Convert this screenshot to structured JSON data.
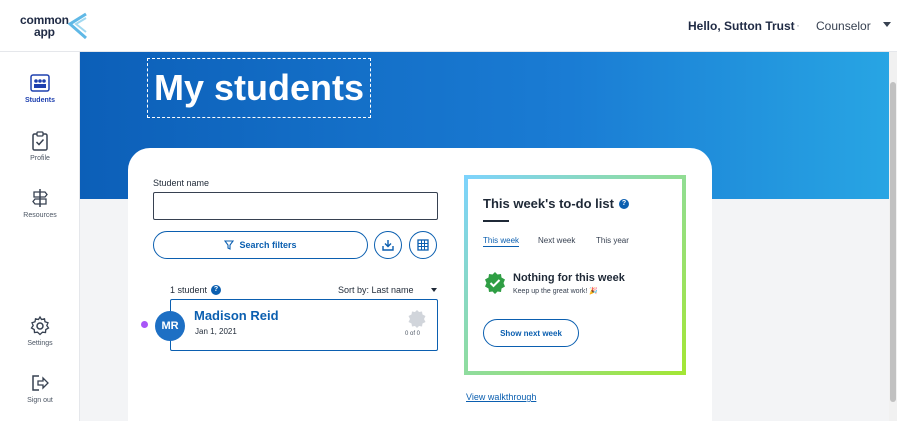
{
  "header": {
    "logo_line1": "common",
    "logo_line2": "app",
    "greeting": "Hello, Sutton Trust",
    "separator": "·",
    "role": "Counselor"
  },
  "sidebar": {
    "items": [
      {
        "label": "Students",
        "icon": "students-icon",
        "active": true
      },
      {
        "label": "Profile",
        "icon": "clipboard-icon",
        "active": false
      },
      {
        "label": "Resources",
        "icon": "signpost-icon",
        "active": false
      },
      {
        "label": "Settings",
        "icon": "gear-icon",
        "active": false
      },
      {
        "label": "Sign out",
        "icon": "sign-out-icon",
        "active": false
      }
    ]
  },
  "main": {
    "title": "My students",
    "search": {
      "label": "Student name",
      "value": "",
      "filters_label": "Search filters"
    },
    "results": {
      "count_text": "1 student",
      "sort_text": "Sort by: Last name"
    },
    "students": [
      {
        "initials": "MR",
        "name": "Madison Reid",
        "date": "Jan 1, 2021",
        "progress": "0 of 0"
      }
    ],
    "todo": {
      "title": "This week's to-do list",
      "tabs": [
        "This week",
        "Next week",
        "This year"
      ],
      "active_tab": "This week",
      "empty_title": "Nothing for this week",
      "empty_subtitle": "Keep up the great work! 🎉",
      "button": "Show next week"
    },
    "walkthrough": "View walkthrough"
  },
  "colors": {
    "brand_blue": "#0b5fb0",
    "banner_start": "#0c5fb8",
    "banner_end": "#28a6e4",
    "status_purple": "#a855f7",
    "success_green": "#2f9e44"
  }
}
